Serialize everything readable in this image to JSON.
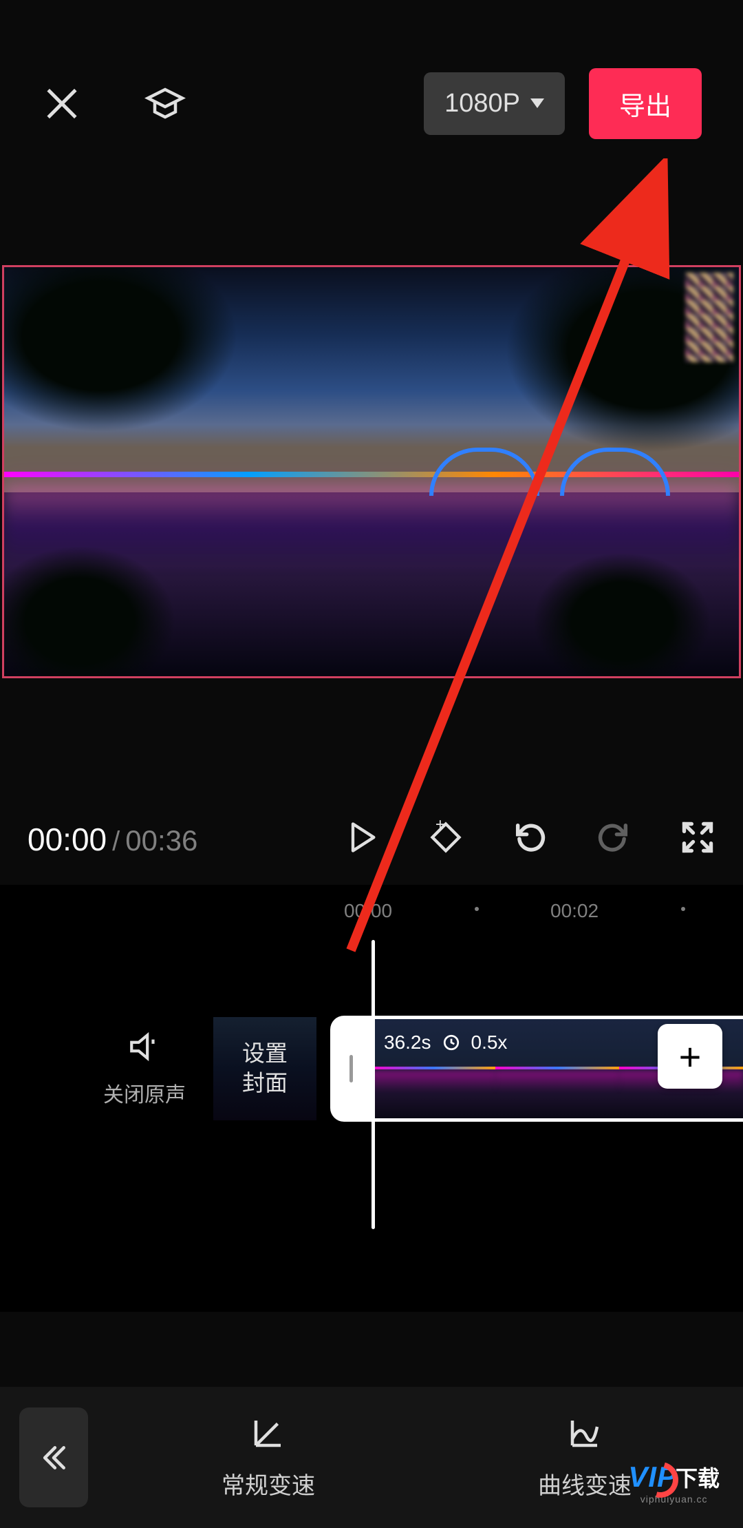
{
  "header": {
    "resolution": "1080P",
    "export": "导出"
  },
  "time": {
    "current": "00:00",
    "separator": "/",
    "total": "00:36"
  },
  "ruler": {
    "t0": "00:00",
    "t1": "00:02"
  },
  "audio": {
    "mute_label": "关闭原声"
  },
  "cover": {
    "label": "设置\n封面"
  },
  "clip": {
    "duration": "36.2s",
    "speed": "0.5x"
  },
  "bottom": {
    "normal_speed": "常规变速",
    "curve_speed": "曲线变速"
  },
  "watermark": {
    "logo_prefix": "VIP",
    "text": "下载",
    "url": "viphuiyuan.cc"
  },
  "colors": {
    "accent": "#fe2c55",
    "preview_border": "#d04060"
  }
}
